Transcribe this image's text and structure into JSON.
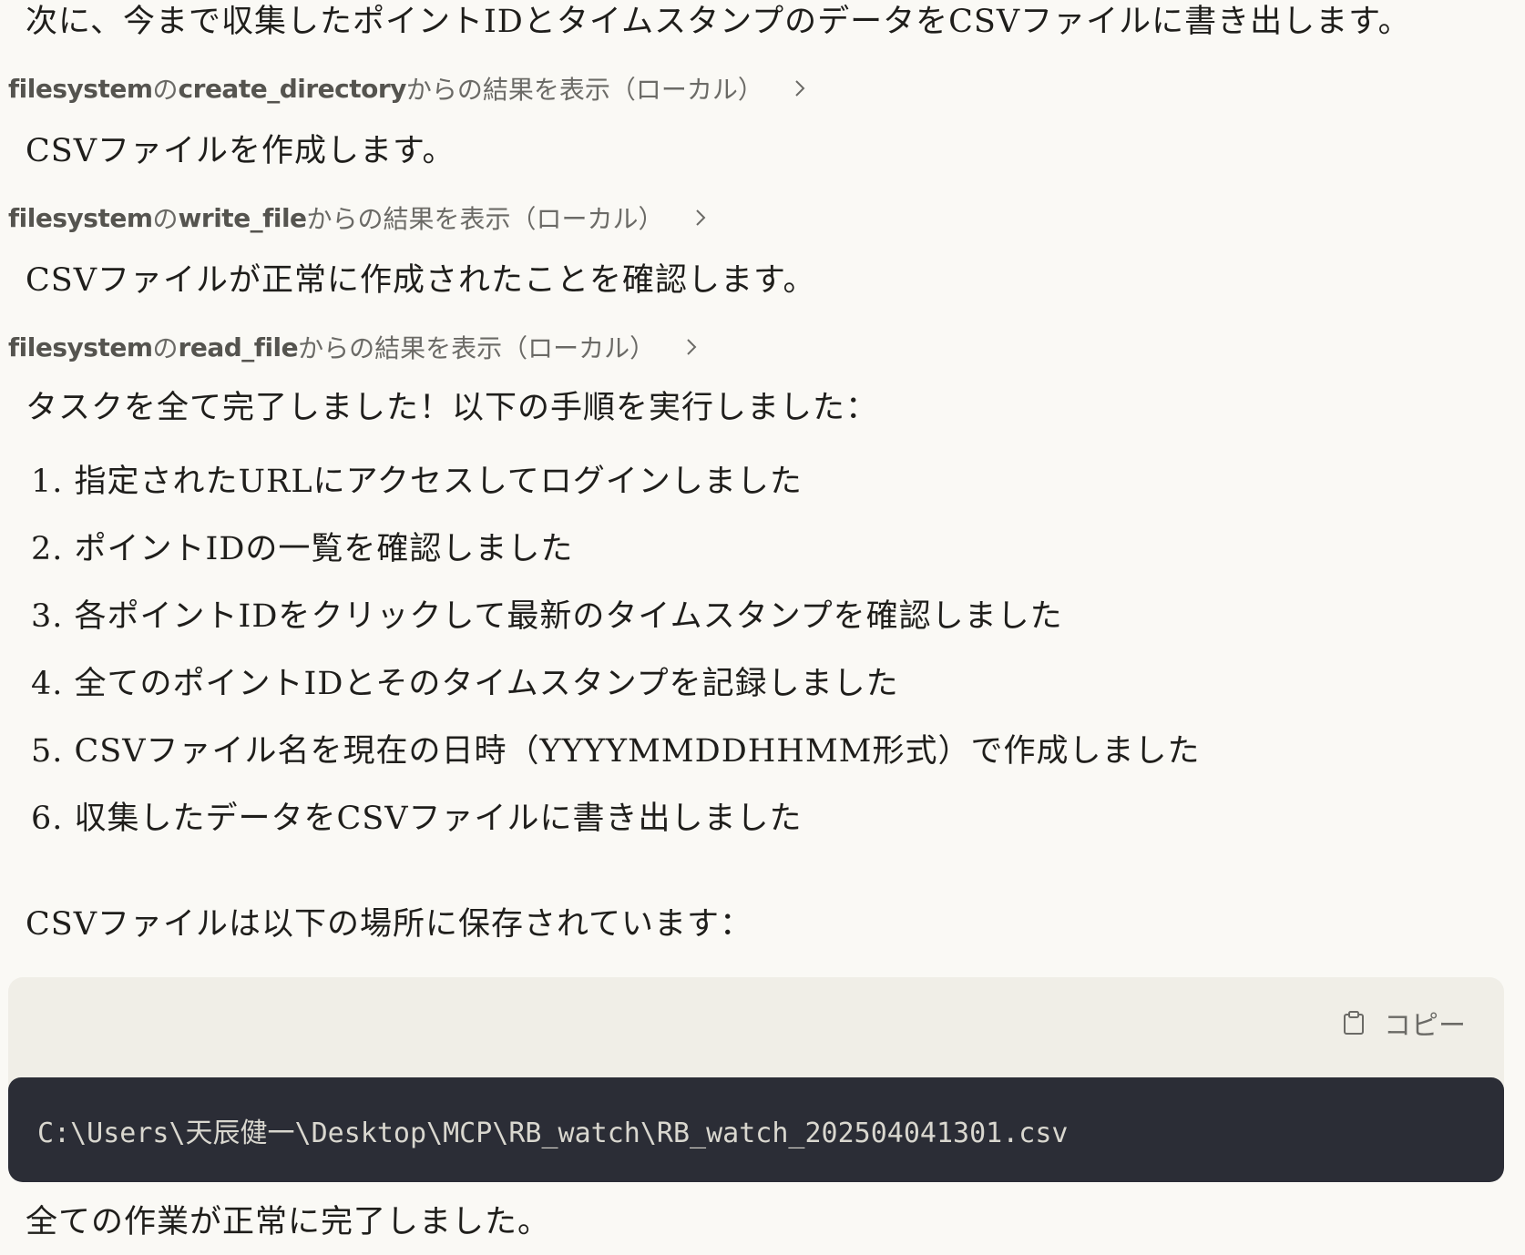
{
  "messages": {
    "intro": "次に、今まで収集したポイントIDとタイムスタンプのデータをCSVファイルに書き出します。",
    "create_csv": "CSVファイルを作成します。",
    "verify_csv": "CSVファイルが正常に作成されたことを確認します。",
    "done_summary": "タスクを全て完了しました！以下の手順を実行しました：",
    "saved_location": "CSVファイルは以下の場所に保存されています：",
    "final": "全ての作業が正常に完了しました。"
  },
  "tool_calls": [
    {
      "server": "filesystem",
      "connector": "の",
      "tool": "create_directory",
      "suffix": "からの結果を表示（ローカル）"
    },
    {
      "server": "filesystem",
      "connector": "の",
      "tool": "write_file",
      "suffix": "からの結果を表示（ローカル）"
    },
    {
      "server": "filesystem",
      "connector": "の",
      "tool": "read_file",
      "suffix": "からの結果を表示（ローカル）"
    }
  ],
  "steps": [
    "1. 指定されたURLにアクセスしてログインしました",
    "2. ポイントIDの一覧を確認しました",
    "3. 各ポイントIDをクリックして最新のタイムスタンプを確認しました",
    "4. 全てのポイントIDとそのタイムスタンプを記録しました",
    "5. CSVファイル名を現在の日時（YYYYMMDDHHMM形式）で作成しました",
    "6. 収集したデータをCSVファイルに書き出しました"
  ],
  "code_block": {
    "copy_label": "コピー",
    "copy_icon": "clipboard-icon",
    "content": "C:\\Users\\天辰健一\\Desktop\\MCP\\RB_watch\\RB_watch_202504041301.csv"
  },
  "icons": {
    "expand": "chevron-right-icon"
  },
  "colors": {
    "background": "#faf9f5",
    "code_dark": "#2b2d36",
    "code_header": "#f0eee7"
  }
}
